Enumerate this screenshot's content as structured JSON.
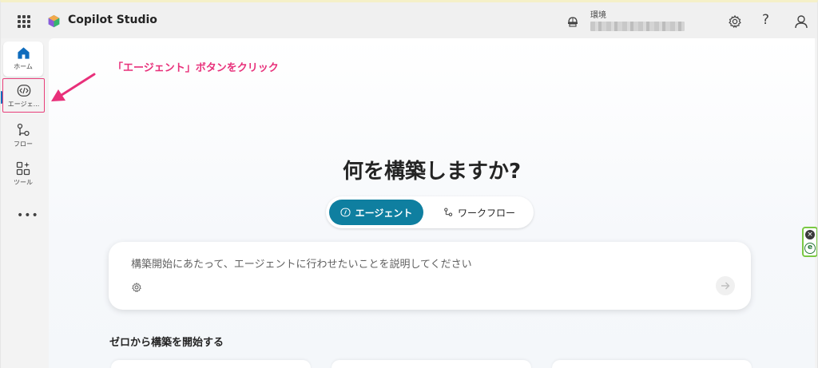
{
  "header": {
    "app_title": "Copilot Studio",
    "environment_label": "環境",
    "help_label": "?"
  },
  "nav": {
    "items": [
      {
        "label": "ホーム",
        "icon": "home-icon"
      },
      {
        "label": "エージェ...",
        "icon": "agent-icon"
      },
      {
        "label": "フロー",
        "icon": "flow-icon"
      },
      {
        "label": "ツール",
        "icon": "tools-icon"
      }
    ],
    "more_label": "•••"
  },
  "annotation": {
    "text": "「エージェント」ボタンをクリック",
    "color": "#e8307a"
  },
  "main": {
    "headline": "何を構築しますか?",
    "toggle": {
      "agent_label": "エージェント",
      "flow_label": "ワークフロー"
    },
    "prompt": {
      "placeholder": "構築開始にあたって、エージェントに行わせたいことを説明してください"
    },
    "section_title": "ゼロから構築を開始する"
  },
  "colors": {
    "accent": "#0f7fa0",
    "annotation": "#e8307a"
  }
}
